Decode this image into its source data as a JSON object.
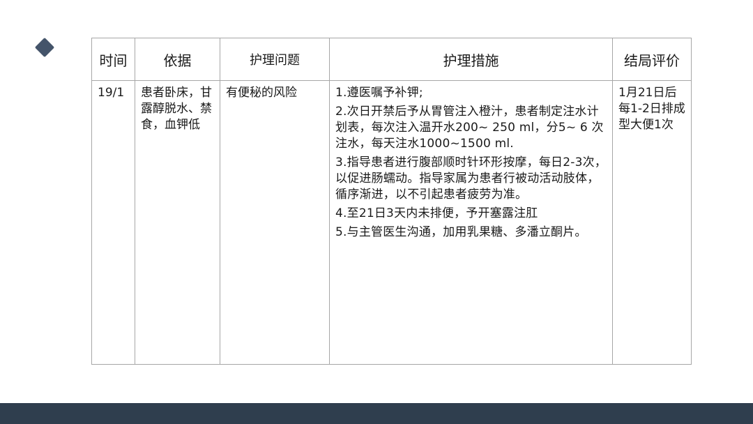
{
  "table": {
    "headers": {
      "time": "时间",
      "basis": "依据",
      "problem": "护理问题",
      "measures": "护理措施",
      "evaluation": "结局评价"
    },
    "row": {
      "time": "19/1",
      "basis": "患者卧床，甘露醇脱水、禁食，血钾低",
      "problem": "有便秘的风险",
      "measures": [
        "1.遵医嘱予补钾;",
        "2.次日开禁后予从胃管注入橙汁，患者制定注水计划表，每次注入温开水200~ 250 ml，分5~ 6 次注水，每天注水1000~1500 ml.",
        "3.指导患者进行腹部顺时针环形按摩，每日2-3次，以促进肠蠕动。指导家属为患者行被动活动肢体，循序渐进，以不引起患者疲劳为准。",
        "4.至21日3天内未排便，予开塞露注肛",
        "5.与主管医生沟通，加用乳果糖、多潘立酮片。"
      ],
      "evaluation": "1月21日后每1-2日排成型大便1次"
    }
  },
  "colors": {
    "accent": "#44546a",
    "footer_bar": "#2f3e4e",
    "border": "#a6a6a6"
  }
}
